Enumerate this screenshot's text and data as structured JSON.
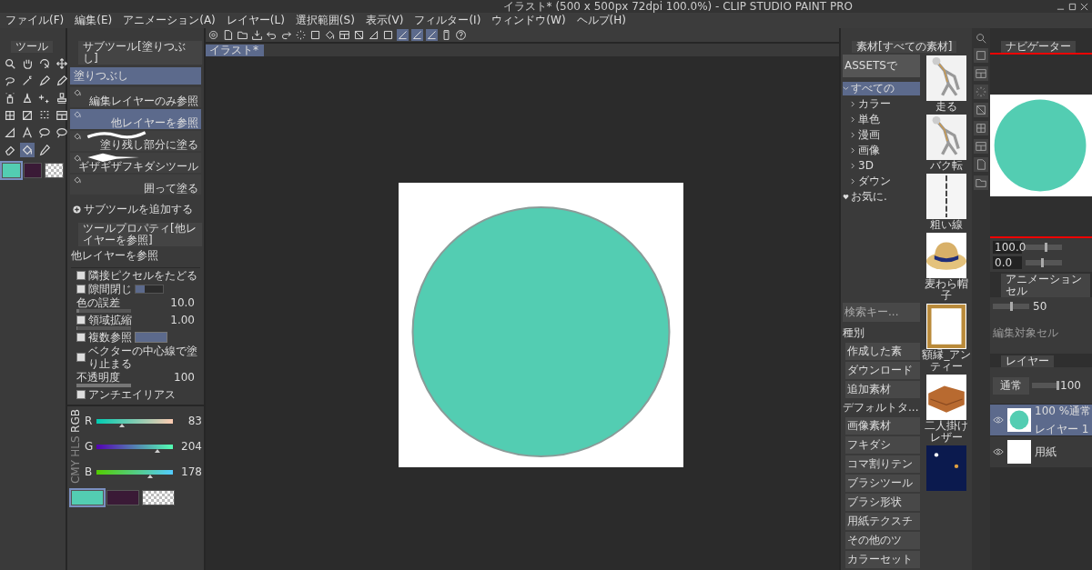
{
  "window": {
    "title": "イラスト* (500 x 500px 72dpi 100.0%) - CLIP STUDIO PAINT PRO"
  },
  "menu": [
    "ファイル(F)",
    "編集(E)",
    "アニメーション(A)",
    "レイヤー(L)",
    "選択範囲(S)",
    "表示(V)",
    "フィルター(I)",
    "ウィンドウ(W)",
    "ヘルプ(H)"
  ],
  "tool_panel": {
    "tab": "ツール",
    "tools": [
      {
        "kind": "zoom",
        "selected": false
      },
      {
        "kind": "hand",
        "selected": false
      },
      {
        "kind": "rotate",
        "selected": false
      },
      {
        "kind": "move",
        "selected": false
      },
      {
        "kind": "lasso",
        "selected": false
      },
      {
        "kind": "wand",
        "selected": false
      },
      {
        "kind": "pen",
        "selected": false
      },
      {
        "kind": "pencil",
        "selected": false
      },
      {
        "kind": "airbrush",
        "selected": false
      },
      {
        "kind": "marker",
        "selected": false
      },
      {
        "kind": "sparkle",
        "selected": false
      },
      {
        "kind": "stamp",
        "selected": false
      },
      {
        "kind": "grid",
        "selected": false
      },
      {
        "kind": "gradient",
        "selected": false
      },
      {
        "kind": "dotgrid",
        "selected": false
      },
      {
        "kind": "frame",
        "selected": false
      },
      {
        "kind": "ruler",
        "selected": false
      },
      {
        "kind": "text",
        "selected": false
      },
      {
        "kind": "balloon",
        "selected": false
      },
      {
        "kind": "balloon",
        "selected": false
      },
      {
        "kind": "eraser",
        "selected": false
      },
      {
        "kind": "fill",
        "selected": true
      },
      {
        "kind": "dropper",
        "selected": false
      }
    ],
    "swatches": [
      {
        "kind": "color",
        "color": "#53cdb2",
        "selected": true
      },
      {
        "kind": "color",
        "color": "#3a1a36",
        "selected": false
      },
      {
        "kind": "transparent",
        "selected": false
      }
    ]
  },
  "subtool_panel": {
    "tab": "サブツール[塗りつぶし]",
    "group": {
      "label": "塗りつぶし",
      "selected": true
    },
    "items": [
      {
        "label": "編集レイヤーのみ参照",
        "kind": "plain",
        "selected": false
      },
      {
        "label": "他レイヤーを参照",
        "kind": "plain",
        "selected": true
      },
      {
        "label": "塗り残し部分に塗る",
        "kind": "stroke",
        "selected": false
      },
      {
        "label": "ギザギザフキダシツール",
        "kind": "spike",
        "selected": false
      },
      {
        "label": "囲って塗る",
        "kind": "plain",
        "selected": false
      }
    ],
    "add_label": "サブツールを追加する"
  },
  "tool_property": {
    "tab": "ツールプロパティ[他レイヤーを参照]",
    "title": "他レイヤーを参照",
    "rows": [
      {
        "kind": "check",
        "label": "隣接ピクセルをたどる",
        "checked": true
      },
      {
        "kind": "segments",
        "label": "隙間閉じ",
        "checked": true,
        "level": 0.33
      },
      {
        "kind": "slider",
        "label": "色の誤差",
        "value": "10.0",
        "level": 0.05
      },
      {
        "kind": "checkslider",
        "label": "領域拡縮",
        "checked": true,
        "value": "1.00",
        "level": 0.02
      },
      {
        "kind": "refer",
        "label": "複数参照",
        "checked": true
      },
      {
        "kind": "check",
        "label": "ベクターの中心線で塗り止まる",
        "checked": true
      },
      {
        "kind": "slider",
        "label": "不透明度",
        "value": "100",
        "level": 1
      },
      {
        "kind": "check",
        "label": "アンチエイリアス",
        "checked": true
      }
    ]
  },
  "color_panel": {
    "modes": [
      {
        "label": "RGB",
        "selected": true
      },
      {
        "label": "HLS",
        "selected": false
      },
      {
        "label": "CMY",
        "selected": false
      }
    ],
    "sliders": [
      {
        "label": "R",
        "value": "83",
        "level": 0.325
      },
      {
        "label": "G",
        "value": "204",
        "level": 0.8
      },
      {
        "label": "B",
        "value": "178",
        "level": 0.698
      }
    ],
    "swatches": [
      {
        "kind": "color",
        "color": "#53cdb2",
        "selected": true
      },
      {
        "kind": "color",
        "color": "#3a1a36",
        "selected": false
      },
      {
        "kind": "transparent",
        "selected": false
      }
    ]
  },
  "toolbar": [
    {
      "kind": "swirl",
      "selected": false
    },
    {
      "kind": "doc",
      "selected": false
    },
    {
      "kind": "folder",
      "selected": false
    },
    {
      "kind": "download",
      "selected": false
    },
    {
      "kind": "undo",
      "selected": false
    },
    {
      "kind": "redo",
      "selected": false
    },
    {
      "kind": "marquee",
      "selected": false
    },
    {
      "kind": "square",
      "selected": false
    },
    {
      "kind": "fill",
      "selected": false
    },
    {
      "kind": "frame",
      "selected": false
    },
    {
      "kind": "diag",
      "selected": false
    },
    {
      "kind": "ruler",
      "selected": false
    },
    {
      "kind": "square",
      "selected": false
    },
    {
      "kind": "line",
      "selected": true
    },
    {
      "kind": "line",
      "selected": true
    },
    {
      "kind": "line",
      "selected": true
    },
    {
      "kind": "device",
      "selected": false
    },
    {
      "kind": "help",
      "selected": false
    }
  ],
  "canvas": {
    "tab": "イラスト*"
  },
  "asset_panel": {
    "tab": "素材[すべての素材]",
    "assets_button": "ASSETSで",
    "tree": {
      "label": "すべての",
      "expanded": true,
      "selected": true,
      "children": [
        {
          "label": "カラー"
        },
        {
          "label": "単色"
        },
        {
          "label": "漫画"
        },
        {
          "label": "画像"
        },
        {
          "label": "3D"
        },
        {
          "label": "ダウン"
        }
      ]
    },
    "favorites": "お気に.",
    "search": {
      "placeholder": "検索キー..."
    },
    "categories": [
      {
        "kind": "header",
        "label": "種別"
      },
      {
        "kind": "button",
        "label": "作成した素"
      },
      {
        "kind": "button",
        "label": "ダウンロード"
      },
      {
        "kind": "button",
        "label": "追加素材"
      },
      {
        "kind": "header",
        "label": "デフォルトタ..."
      },
      {
        "kind": "button",
        "label": "画像素材"
      },
      {
        "kind": "button",
        "label": "フキダシ"
      },
      {
        "kind": "button",
        "label": "コマ割りテン"
      },
      {
        "kind": "button",
        "label": "ブラシツール"
      },
      {
        "kind": "button",
        "label": "ブラシ形状"
      },
      {
        "kind": "button",
        "label": "用紙テクスチ"
      },
      {
        "kind": "button",
        "label": "その他のツ"
      },
      {
        "kind": "button",
        "label": "カラーセット"
      }
    ],
    "thumbnails": [
      {
        "kind": "figure",
        "label": "走る"
      },
      {
        "kind": "figure",
        "label": "バク転"
      },
      {
        "kind": "line",
        "label": "粗い線"
      },
      {
        "kind": "hat",
        "label": "麦わら帽子"
      },
      {
        "kind": "frame",
        "label": "額縁_アンティー"
      },
      {
        "kind": "sofa",
        "label": "二人掛けレザー"
      },
      {
        "kind": "night"
      }
    ]
  },
  "navigator": {
    "tab": "ナビゲーター",
    "zoom": {
      "value": "100.0",
      "level": 0.55
    },
    "angle": {
      "value": "0.0",
      "level": 0.45
    }
  },
  "animation_panel": {
    "tab": "アニメーションセル",
    "opacity": {
      "value": "50",
      "level": 0.5
    },
    "label": "編集対象セル"
  },
  "layer_panel": {
    "tab": "レイヤー",
    "blend": "通常",
    "opacity": {
      "value": "100",
      "level": 1
    },
    "layers": [
      {
        "kind": "paint",
        "name": "レイヤー 1",
        "info": "100 %通常",
        "visible": true,
        "selected": true
      },
      {
        "kind": "paper",
        "name": "用紙",
        "visible": true,
        "selected": false
      }
    ]
  }
}
